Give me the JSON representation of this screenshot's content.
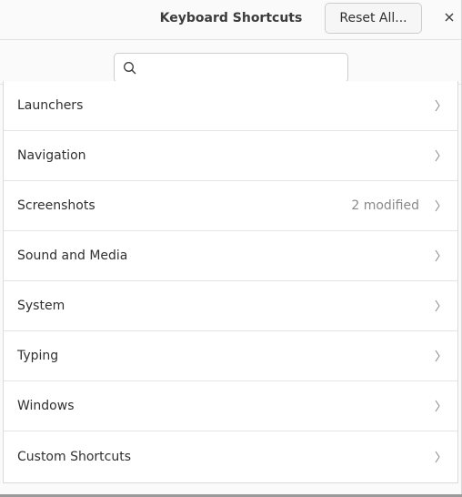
{
  "window": {
    "title": "Keyboard Shortcuts",
    "reset_button_label": "Reset All...",
    "close_icon": "close-icon"
  },
  "search": {
    "placeholder": "",
    "value": "",
    "icon": "search-icon"
  },
  "categories": [
    {
      "label": "Launchers",
      "detail": ""
    },
    {
      "label": "Navigation",
      "detail": ""
    },
    {
      "label": "Screenshots",
      "detail": "2 modified"
    },
    {
      "label": "Sound and Media",
      "detail": ""
    },
    {
      "label": "System",
      "detail": ""
    },
    {
      "label": "Typing",
      "detail": ""
    },
    {
      "label": "Windows",
      "detail": ""
    },
    {
      "label": "Custom Shortcuts",
      "detail": ""
    }
  ],
  "colors": {
    "background": "#fafafa",
    "list_background": "#ffffff",
    "text": "#303030",
    "detail_text": "#8a8a8a",
    "border": "#dadada"
  }
}
